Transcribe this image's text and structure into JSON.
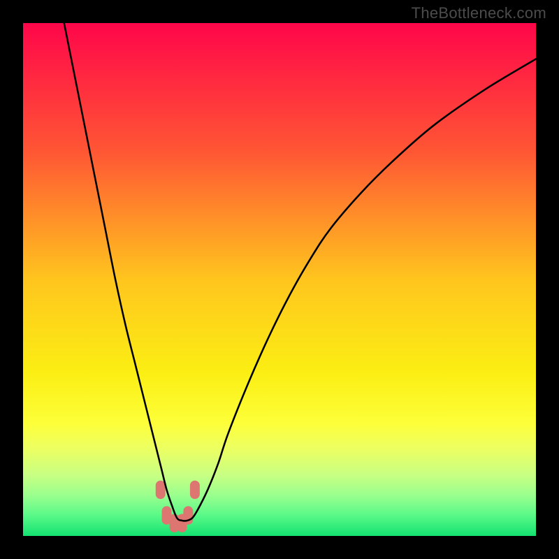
{
  "watermark": "TheBottleneck.com",
  "chart_data": {
    "type": "line",
    "title": "",
    "xlabel": "",
    "ylabel": "",
    "xlim": [
      0,
      100
    ],
    "ylim": [
      0,
      100
    ],
    "grid": false,
    "legend": false,
    "background": {
      "type": "vertical-gradient",
      "stops": [
        {
          "pos": 0,
          "color": "#ff064a"
        },
        {
          "pos": 25,
          "color": "#ff5634"
        },
        {
          "pos": 50,
          "color": "#ffc51e"
        },
        {
          "pos": 68,
          "color": "#fbee13"
        },
        {
          "pos": 78,
          "color": "#fdff39"
        },
        {
          "pos": 83,
          "color": "#ecff62"
        },
        {
          "pos": 88,
          "color": "#c9ff82"
        },
        {
          "pos": 92,
          "color": "#9bff8e"
        },
        {
          "pos": 96,
          "color": "#59f988"
        },
        {
          "pos": 100,
          "color": "#13e271"
        }
      ]
    },
    "series": [
      {
        "name": "bottleneck-curve",
        "x": [
          8,
          10,
          12,
          14,
          16,
          18,
          20,
          22,
          24,
          26,
          27,
          28,
          29,
          30,
          31,
          32,
          33,
          34,
          36,
          38,
          40,
          44,
          48,
          52,
          56,
          60,
          66,
          72,
          80,
          90,
          100
        ],
        "y": [
          100,
          90,
          80,
          70,
          60,
          50,
          41,
          33,
          25,
          17,
          13,
          9,
          6,
          3.5,
          3,
          3,
          3.5,
          5,
          9,
          14,
          20,
          30,
          39,
          47,
          54,
          60,
          67,
          73,
          80,
          87,
          93
        ]
      }
    ],
    "marker_cluster": {
      "note": "salmon rounded markers near curve minimum",
      "color": "#dd7571",
      "points": [
        {
          "x": 26.8,
          "y": 9
        },
        {
          "x": 28.0,
          "y": 4
        },
        {
          "x": 29.5,
          "y": 2.5
        },
        {
          "x": 31.0,
          "y": 2.5
        },
        {
          "x": 32.2,
          "y": 4
        },
        {
          "x": 33.5,
          "y": 9
        }
      ]
    }
  }
}
